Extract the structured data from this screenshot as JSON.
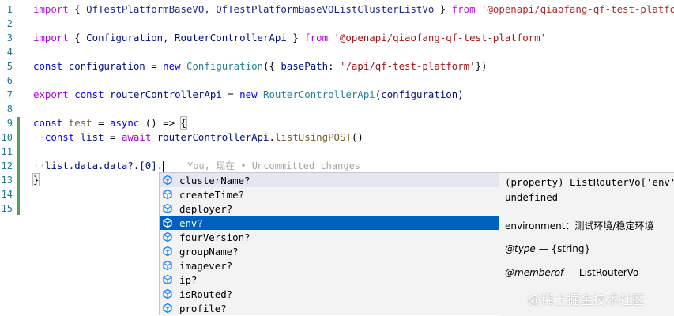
{
  "editor": {
    "line_numbers": [
      "1",
      "2",
      "3",
      "4",
      "5",
      "6",
      "7",
      "8",
      "9",
      "10",
      "11",
      "12",
      "13",
      "14",
      "15"
    ],
    "lines": {
      "l1": {
        "import_kw": "import",
        "open": " { ",
        "names": "QfTestPlatformBaseVO, QfTestPlatformBaseVOListClusterListVo",
        "close": " } ",
        "from_kw": "from",
        "module": "'@openapi/qiaofang-qf-test-platform'"
      },
      "l3": {
        "import_kw": "import",
        "open": " { ",
        "names": "Configuration, RouterControllerApi",
        "close": " } ",
        "from_kw": "from",
        "module": "'@openapi/qiaofang-qf-test-platform'"
      },
      "l5": {
        "const_kw": "const",
        "var": "configuration",
        "eq": " = ",
        "new_kw": "new",
        "cls": "Configuration",
        "open": "({ ",
        "prop": "basePath",
        "colon": ": ",
        "str": "'/api/qf-test-platform'",
        "close": "})"
      },
      "l7": {
        "export_kw": "export",
        "const_kw": "const",
        "var": "routerControllerApi",
        "eq": " = ",
        "new_kw": "new",
        "cls": "RouterControllerApi",
        "open": "(",
        "arg": "configuration",
        "close": ")"
      },
      "l9": {
        "const_kw": "const",
        "fn": "test",
        "eq": " = ",
        "async_kw": "async",
        "arrow": " () => ",
        "brace": "{"
      },
      "l10": {
        "const_kw": "const",
        "var": "list",
        "eq": " = ",
        "await_kw": "await",
        "obj": "routerControllerApi",
        "dot": ".",
        "method": "listUsingPOST",
        "call": "()"
      },
      "l12": {
        "expr": "list.data.data?.[0].",
        "blame": "You, 现在 • Uncommitted changes"
      },
      "l13": {
        "brace": "}"
      }
    }
  },
  "suggest": {
    "items": [
      {
        "label": "clusterName?",
        "icon": "property-icon"
      },
      {
        "label": "createTime?",
        "icon": "property-icon"
      },
      {
        "label": "deployer?",
        "icon": "property-icon"
      },
      {
        "label": "env?",
        "icon": "property-icon"
      },
      {
        "label": "fourVersion?",
        "icon": "property-icon"
      },
      {
        "label": "groupName?",
        "icon": "property-icon"
      },
      {
        "label": "imagever?",
        "icon": "property-icon"
      },
      {
        "label": "ip?",
        "icon": "property-icon"
      },
      {
        "label": "isRouted?",
        "icon": "property-icon"
      },
      {
        "label": "profile?",
        "icon": "property-icon"
      }
    ],
    "selected_index": 3,
    "detail": {
      "signature": "(property) ListRouterVo['env']",
      "type_line": "undefined",
      "doc": "environment：测试环境/稳定环境",
      "tag_type_name": "@type",
      "tag_type_value": " — {string}",
      "tag_member_name": "@memberof",
      "tag_member_value": " — ListRouterVo"
    }
  },
  "watermark": "@稀土掘金技术社区",
  "colors": {
    "selection": "#0060c0",
    "line_number": "#237893",
    "keyword": "#0000ff",
    "control_keyword": "#af00db",
    "string": "#a31515",
    "class": "#267f99",
    "function": "#795e26",
    "variable": "#001080",
    "git_modified": "#589a5f"
  }
}
